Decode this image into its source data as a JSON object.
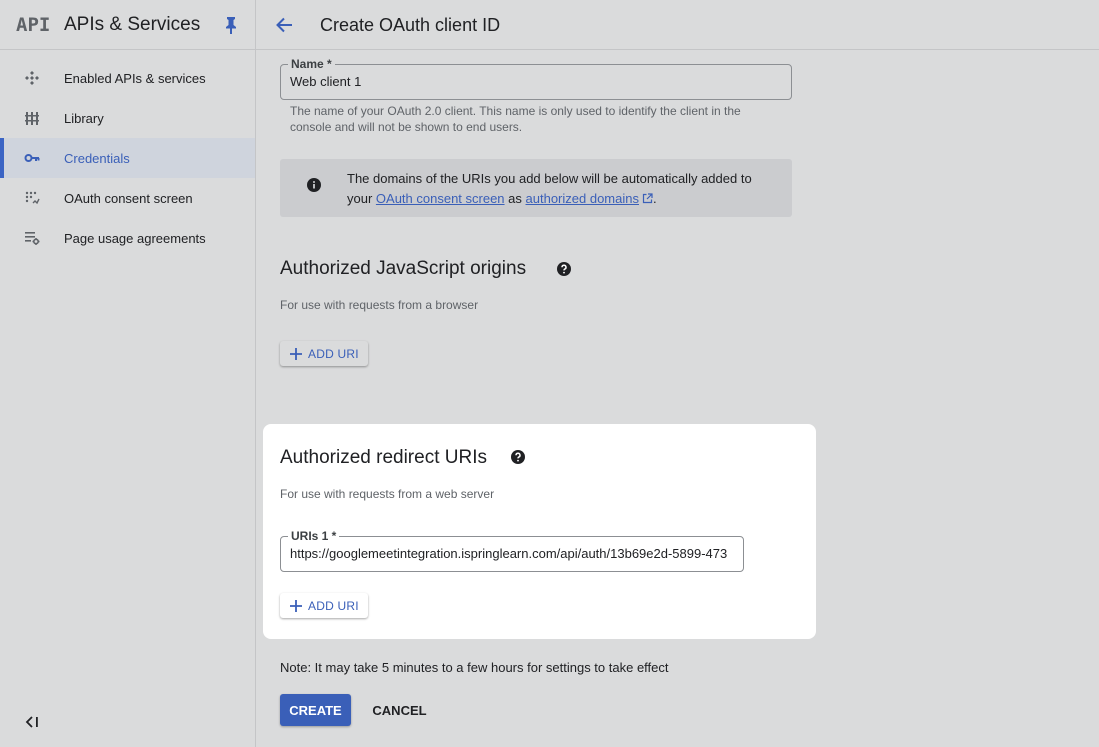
{
  "sidebar": {
    "logo": "API",
    "title": "APIs & Services",
    "items": [
      {
        "label": "Enabled APIs & services",
        "icon": "enabled-apis-icon"
      },
      {
        "label": "Library",
        "icon": "library-icon"
      },
      {
        "label": "Credentials",
        "icon": "key-icon",
        "active": true
      },
      {
        "label": "OAuth consent screen",
        "icon": "consent-screen-icon"
      },
      {
        "label": "Page usage agreements",
        "icon": "settings-list-icon"
      }
    ]
  },
  "header": {
    "title": "Create OAuth client ID"
  },
  "name_field": {
    "label": "Name *",
    "value": "Web client 1",
    "helper": "The name of your OAuth 2.0 client. This name is only used to identify the client in the console and will not be shown to end users."
  },
  "info": {
    "text_before": "The domains of the URIs you add below will be automatically added to your ",
    "link1": "OAuth consent screen",
    "text_middle": " as ",
    "link2": "authorized domains",
    "text_after": "."
  },
  "js_origins": {
    "title": "Authorized JavaScript origins",
    "subtitle": "For use with requests from a browser",
    "add_label": "ADD URI"
  },
  "redirect_uris": {
    "title": "Authorized redirect URIs",
    "subtitle": "For use with requests from a web server",
    "field_label": "URIs 1 *",
    "field_value": "https://googlemeetintegration.ispringlearn.com/api/auth/13b69e2d-5899-473",
    "add_label": "ADD URI"
  },
  "note": "Note: It may take 5 minutes to a few hours for settings to take effect",
  "actions": {
    "create": "CREATE",
    "cancel": "CANCEL"
  },
  "colors": {
    "accent": "#3a5fb8",
    "background": "#dadbdc",
    "card": "#ffffff"
  }
}
